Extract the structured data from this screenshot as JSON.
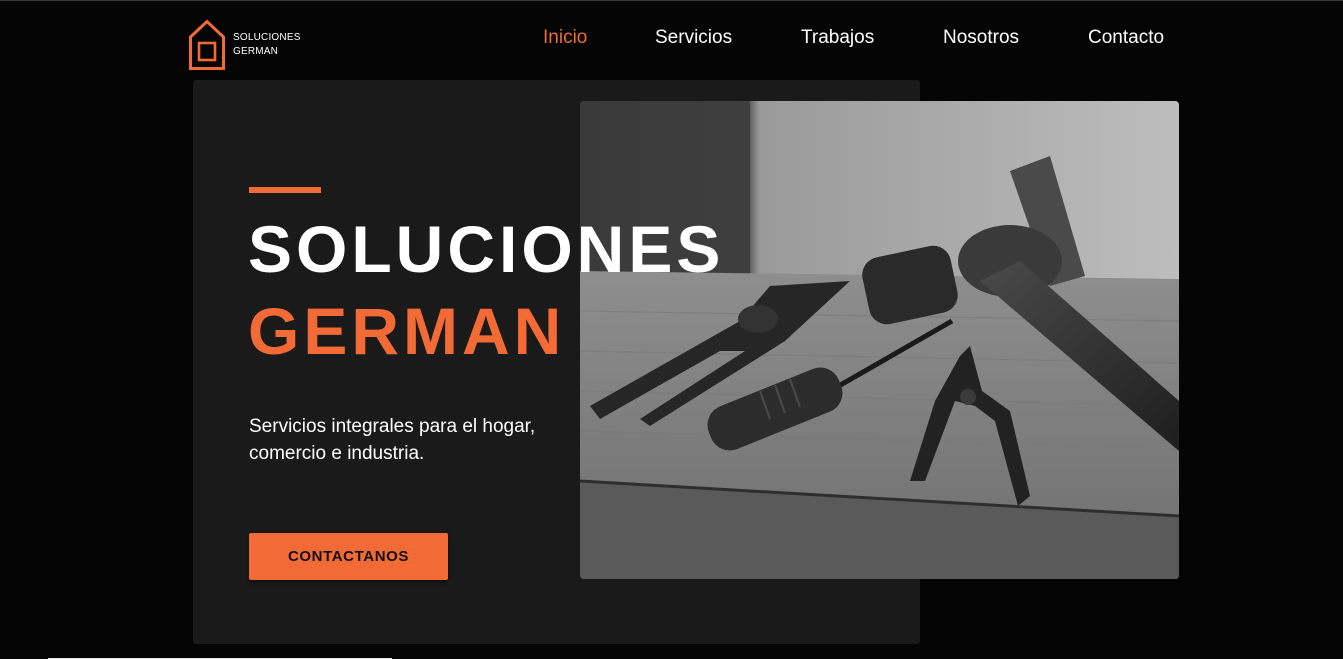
{
  "brand": {
    "line1": "SOLUCIONES",
    "line2": "GERMAN",
    "logo_icon": "house-outline-icon",
    "accent_color": "#f26a35"
  },
  "nav": {
    "items": [
      {
        "label": "Inicio",
        "active": true
      },
      {
        "label": "Servicios",
        "active": false
      },
      {
        "label": "Trabajos",
        "active": false
      },
      {
        "label": "Nosotros",
        "active": false
      },
      {
        "label": "Contacto",
        "active": false
      }
    ]
  },
  "hero": {
    "title_line1": "SOLUCIONES",
    "title_line2": "GERMAN",
    "subtitle": "Servicios integrales para el hogar, comercio e industria.",
    "cta_label": "CONTACTANOS",
    "image_subject": "black-and-white photo of tools (pliers, screwdriver, hammer) on a wooden board"
  },
  "colors": {
    "background": "#050505",
    "card": "#1a1a1a",
    "accent": "#f26a35",
    "text": "#ffffff"
  }
}
